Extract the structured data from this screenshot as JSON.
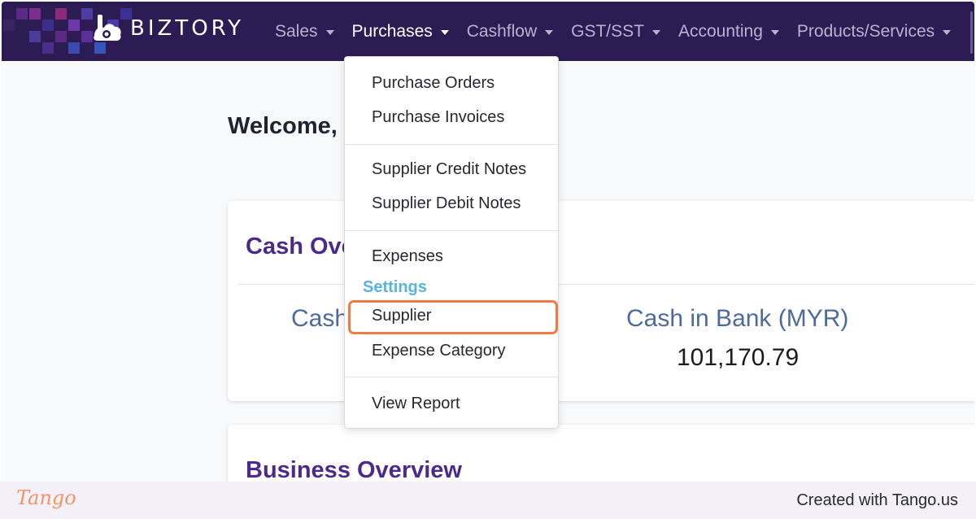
{
  "brand": {
    "name": "BIZTORY"
  },
  "nav": {
    "items": [
      {
        "label": "Sales",
        "active": false
      },
      {
        "label": "Purchases",
        "active": true
      },
      {
        "label": "Cashflow",
        "active": false
      },
      {
        "label": "GST/SST",
        "active": false
      },
      {
        "label": "Accounting",
        "active": false
      },
      {
        "label": "Products/Services",
        "active": false
      }
    ]
  },
  "dropdown": {
    "purchase_orders": "Purchase Orders",
    "purchase_invoices": "Purchase Invoices",
    "supplier_credit_notes": "Supplier Credit Notes",
    "supplier_debit_notes": "Supplier Debit Notes",
    "expenses": "Expenses",
    "settings_header": "Settings",
    "supplier": "Supplier",
    "expense_category": "Expense Category",
    "view_report": "View Report"
  },
  "main": {
    "welcome": "Welcome,",
    "cash_overview": {
      "title": "Cash Ove",
      "left_label": "Cash",
      "right_label": "Cash in Bank (MYR)",
      "right_value": "101,170.79"
    },
    "business_overview": {
      "title": "Business Overview"
    }
  },
  "footer": {
    "logo": "Tango",
    "credit": "Created with Tango.us"
  },
  "colors": {
    "navbar": "#2d1c54",
    "accent_purple": "#4b2a8a",
    "settings_blue": "#57b4dc",
    "highlight_orange": "#f07a45"
  }
}
